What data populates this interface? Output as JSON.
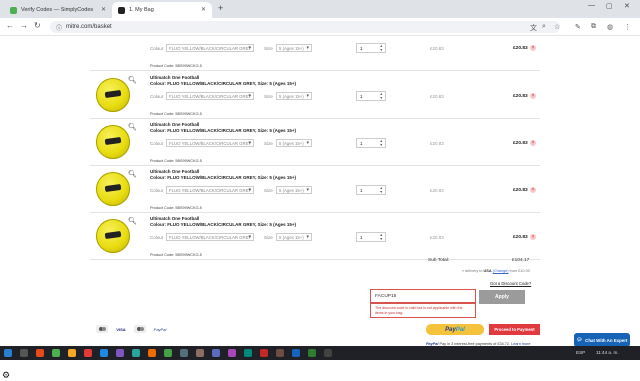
{
  "browser": {
    "tabs": [
      {
        "label": "Verify Codes — SimplyCodes",
        "color": "#4caf50"
      },
      {
        "label": "1. My Bag",
        "color": "#222222"
      }
    ],
    "url": "mitre.com/basket"
  },
  "cart": {
    "labels": {
      "colour": "Colour",
      "size": "Size",
      "colour_value": "FLUO YELLOW/BLACK/CIRCULAR GREY",
      "size_value": "5 (Ages 15+)",
      "qty": "1",
      "unit_price": "£20.83",
      "line_total": "£20.83",
      "remove": "×"
    },
    "items": [
      {
        "name": "",
        "colour_line": "",
        "code": "Product Code: 5BS99WCKG-5"
      },
      {
        "name": "Ultimatch One Football",
        "colour_line": "Colour: FLUO YELLOW/BLACK/CIRCULAR GREY, Size: 5 (Ages 15+)",
        "code": "Product Code: 5BS99WCKG-5"
      },
      {
        "name": "Ultimatch One Football",
        "colour_line": "Colour: FLUO YELLOW/BLACK/CIRCULAR GREY, Size: 5 (Ages 15+)",
        "code": "Product Code: 5BS99WCKG-5"
      },
      {
        "name": "Ultimatch One Football",
        "colour_line": "Colour: FLUO YELLOW/BLACK/CIRCULAR GREY, Size: 5 (Ages 15+)",
        "code": "Product Code: 5BS99WCKG-5"
      },
      {
        "name": "Ultimatch One Football",
        "colour_line": "Colour: FLUO YELLOW/BLACK/CIRCULAR GREY, Size: 5 (Ages 15+)",
        "code": "Product Code: 5BS99WCKG-5"
      }
    ],
    "subtotal_label": "Sub Total:",
    "subtotal_value": "£104.17",
    "delivery_prefix": "» delivery to",
    "delivery_country": "USA",
    "delivery_change": "(Change)",
    "delivery_suffix": "from £10.00",
    "discount_link": "Got a Discount Code?",
    "coupon_value": "FACUP15",
    "coupon_error": "The discount code is valid but is not applicable with the items in your bag.",
    "apply_label": "Apply",
    "paypal_label_1": "Pay",
    "paypal_label_2": "Pal",
    "payment_label": "Proceed to Payment",
    "paylater": "Pay in 3 interest-free payments of £34.72.",
    "paylater_link": "Learn more",
    "paylater_brand": "PayPal",
    "cards": [
      "VISA",
      "PayPal"
    ]
  },
  "chat": {
    "label": "Chat With An Expert"
  },
  "taskbar": {
    "lang": "ESP",
    "time": "11:44 a. m."
  }
}
